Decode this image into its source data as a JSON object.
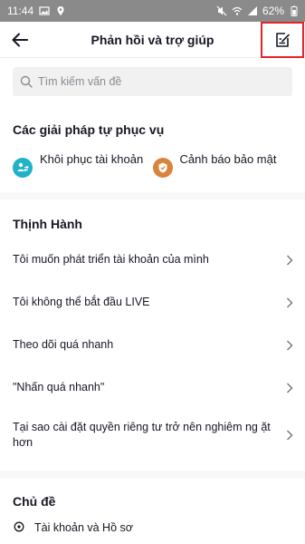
{
  "statusbar": {
    "time": "11:44",
    "battery": "62%"
  },
  "header": {
    "title": "Phản hồi và trợ giúp"
  },
  "search": {
    "placeholder": "Tìm kiếm vấn đề"
  },
  "self_service": {
    "title": "Các giải pháp tự phục vụ",
    "items": [
      {
        "label": "Khôi phục tài khoản",
        "icon": "account-recovery-icon",
        "color": "#20b2c8"
      },
      {
        "label": "Cảnh báo bảo mật",
        "icon": "security-alert-icon",
        "color": "#d9843b"
      }
    ]
  },
  "trending": {
    "title": "Thịnh Hành",
    "items": [
      {
        "label": "Tôi muốn phát triển tài khoản của mình"
      },
      {
        "label": "Tôi không thể bắt đầu LIVE"
      },
      {
        "label": "Theo dõi quá nhanh"
      },
      {
        "label": "\"Nhấn quá nhanh\""
      },
      {
        "label": "Tại sao cài đặt quyền riêng tư trở nên nghiêm ng ặt hơn"
      }
    ]
  },
  "topics": {
    "title": "Chủ đề",
    "items": [
      {
        "label": "Tài khoản và Hồ sơ"
      }
    ]
  },
  "colors": {
    "statusbar": "#8a8a8a",
    "highlight_border": "#e3242b",
    "search_bg": "#f1f1f2",
    "text": "#161823"
  }
}
